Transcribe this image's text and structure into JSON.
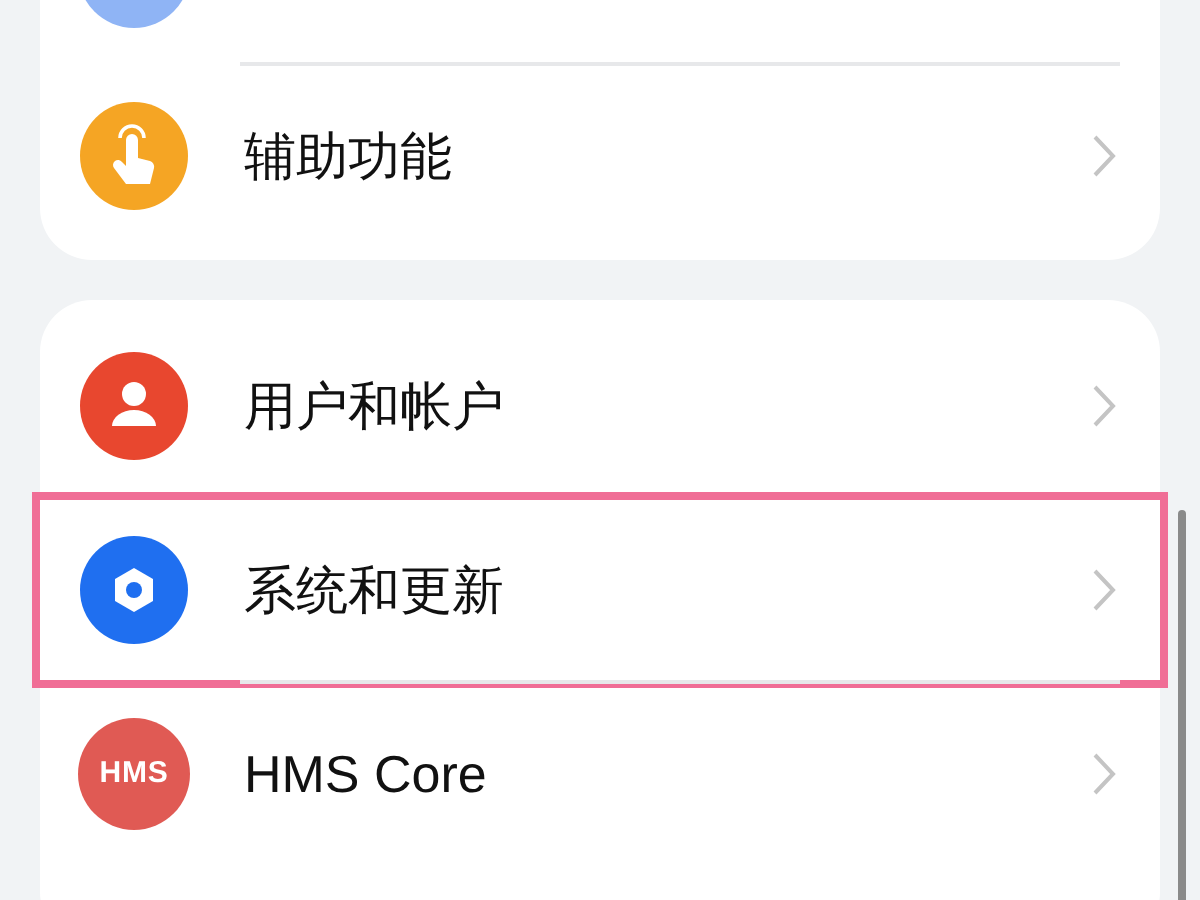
{
  "groups": [
    {
      "items": [
        {
          "kind": "partial",
          "selected": false,
          "color": "#8fb4f5"
        },
        {
          "kind": "hand",
          "label": "辅助功能",
          "selected": false,
          "color": "#f5a524"
        }
      ]
    },
    {
      "items": [
        {
          "kind": "user",
          "label": "用户和帐户",
          "selected": false,
          "color": "#e8472f"
        },
        {
          "kind": "gear",
          "label": "系统和更新",
          "selected": true,
          "color": "#1f6ff0"
        },
        {
          "kind": "badge",
          "label": "HMS Core",
          "icon_text": "HMS",
          "selected": false,
          "color": "#e05a54"
        }
      ]
    }
  ]
}
